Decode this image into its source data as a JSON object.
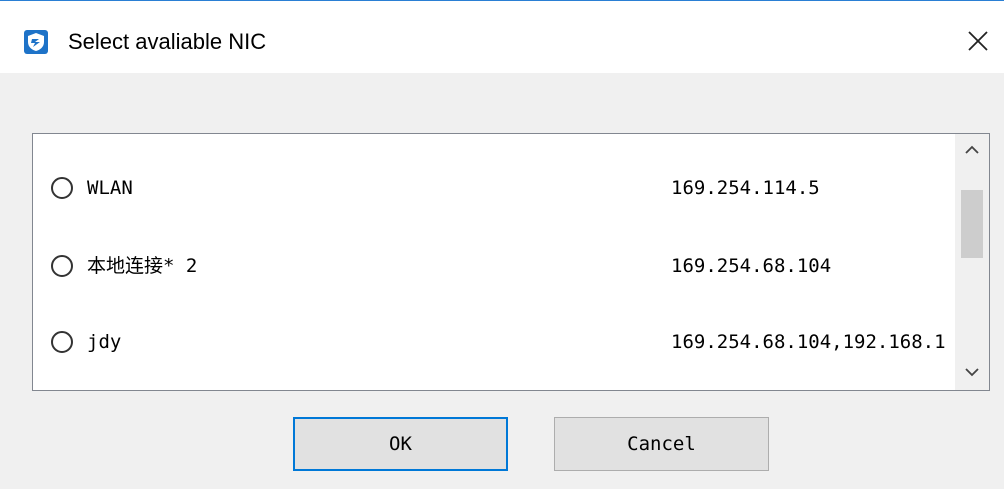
{
  "window": {
    "title": "Select avaliable NIC",
    "accent_color": "#0078d7",
    "app_icon": "shield-app-icon",
    "close_icon": "close-icon"
  },
  "nic_list": {
    "items": [
      {
        "name": "WLAN",
        "ip": "169.254.114.5"
      },
      {
        "name": "本地连接* 2",
        "ip": "169.254.68.104"
      },
      {
        "name": "jdy",
        "ip": "169.254.68.104,192.168.1"
      }
    ],
    "scroll_up_icon": "chevron-up-icon",
    "scroll_down_icon": "chevron-down-icon"
  },
  "buttons": {
    "ok_label": "OK",
    "cancel_label": "Cancel"
  }
}
